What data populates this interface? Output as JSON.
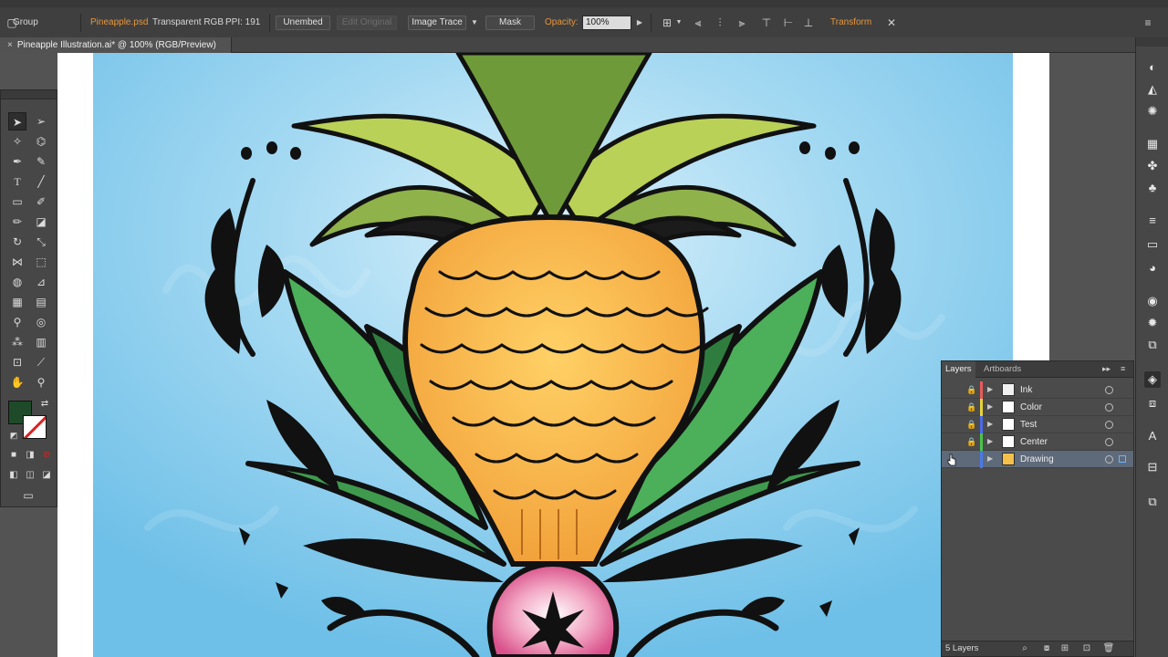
{
  "control_bar": {
    "selection_type": "Group",
    "linked_file": "Pineapple.psd",
    "color_mode": "Transparent RGB",
    "ppi": "PPI: 191",
    "unembed_label": "Unembed",
    "edit_original_label": "Edit Original",
    "image_trace_label": "Image Trace",
    "mask_label": "Mask",
    "opacity_label": "Opacity:",
    "opacity_value": "100%",
    "transform_label": "Transform"
  },
  "document": {
    "tab_title": "Pineapple Illustration.ai* @ 100% (RGB/Preview)",
    "close_glyph": "×"
  },
  "layers_panel": {
    "tabs": [
      "Layers",
      "Artboards"
    ],
    "layers": [
      {
        "name": "Ink",
        "color": "#e85a5a",
        "visible": false,
        "locked": true,
        "selected": false,
        "thumb": "ink"
      },
      {
        "name": "Color",
        "color": "#e8d23a",
        "visible": false,
        "locked": true,
        "selected": false,
        "thumb": "blank"
      },
      {
        "name": "Test",
        "color": "#4a6ae8",
        "visible": false,
        "locked": true,
        "selected": false,
        "thumb": "blank"
      },
      {
        "name": "Center",
        "color": "#4ac44a",
        "visible": false,
        "locked": true,
        "selected": false,
        "thumb": "blank"
      },
      {
        "name": "Drawing",
        "color": "#4a7ae8",
        "visible": true,
        "locked": false,
        "selected": true,
        "thumb": "pineapple"
      }
    ],
    "footer_count": "5 Layers"
  },
  "colors": {
    "sky_blue": "#7cc6ea",
    "fill_swatch": "#1e4a2a",
    "accent_orange": "#e8963a"
  }
}
